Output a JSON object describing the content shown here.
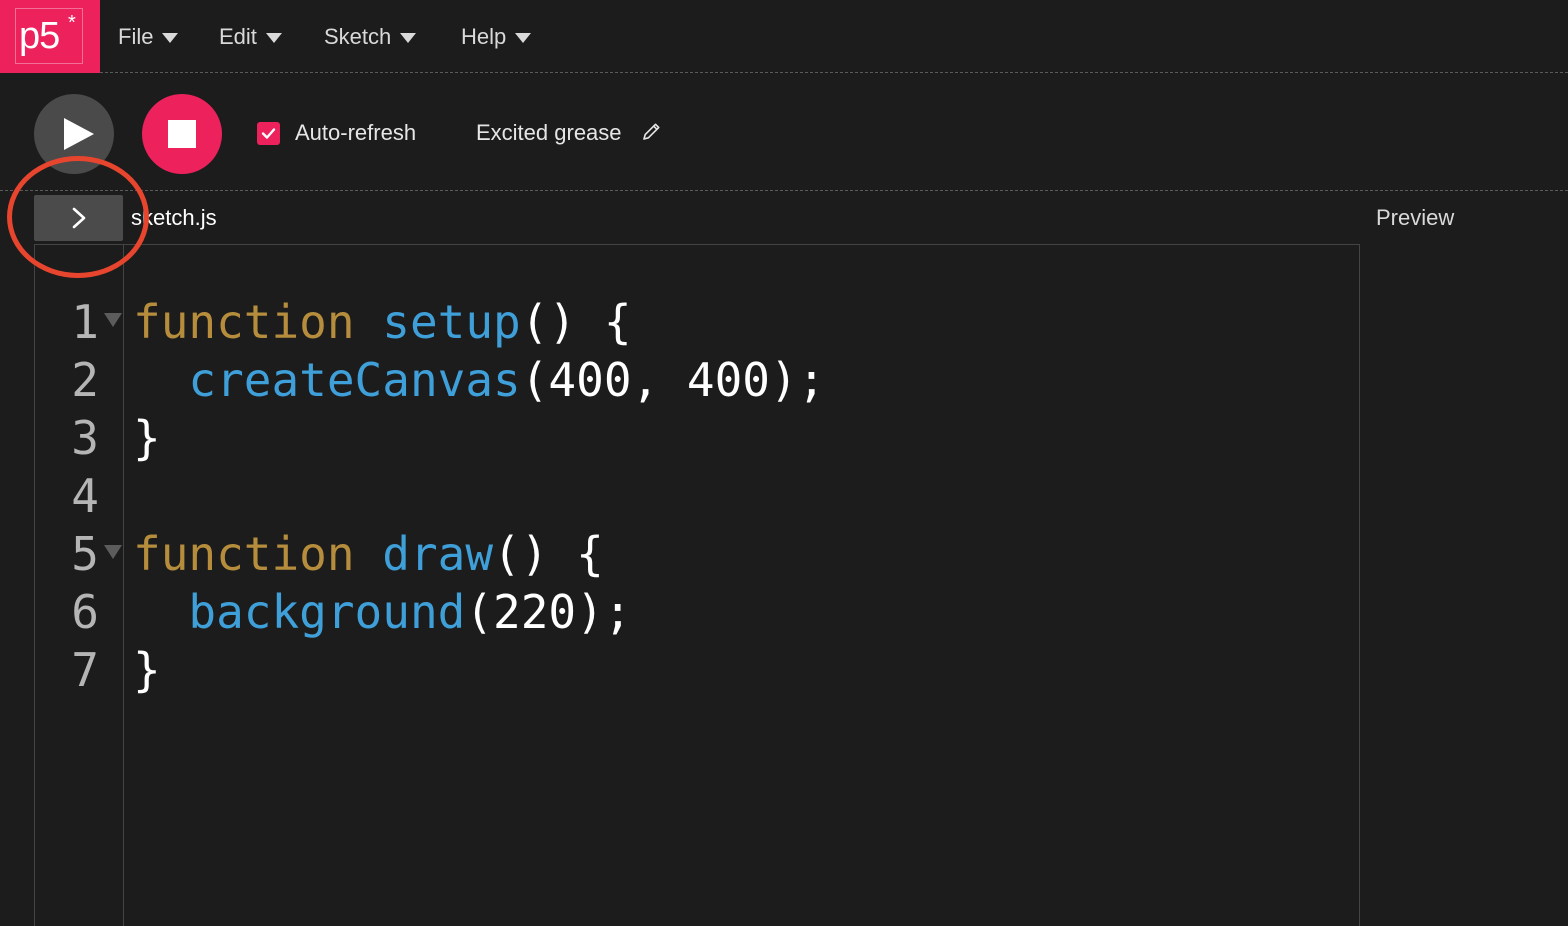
{
  "logo": {
    "text": "p5",
    "star": "*"
  },
  "menu": [
    {
      "label": "File"
    },
    {
      "label": "Edit"
    },
    {
      "label": "Sketch"
    },
    {
      "label": "Help"
    }
  ],
  "toolbar": {
    "auto_refresh_label": "Auto-refresh",
    "auto_refresh_checked": true,
    "sketch_name": "Excited grease"
  },
  "editor": {
    "file_tab": "sketch.js",
    "preview_label": "Preview",
    "lines": [
      {
        "num": "1",
        "foldable": true,
        "tokens": [
          {
            "t": "function",
            "c": "kw"
          },
          {
            "t": " ",
            "c": "pl"
          },
          {
            "t": "setup",
            "c": "fn"
          },
          {
            "t": "() {",
            "c": "pl"
          }
        ]
      },
      {
        "num": "2",
        "foldable": false,
        "tokens": [
          {
            "t": "  ",
            "c": "pl"
          },
          {
            "t": "createCanvas",
            "c": "fn"
          },
          {
            "t": "(400, 400);",
            "c": "pl"
          }
        ]
      },
      {
        "num": "3",
        "foldable": false,
        "tokens": [
          {
            "t": "}",
            "c": "pl"
          }
        ]
      },
      {
        "num": "4",
        "foldable": false,
        "tokens": []
      },
      {
        "num": "5",
        "foldable": true,
        "tokens": [
          {
            "t": "function",
            "c": "kw"
          },
          {
            "t": " ",
            "c": "pl"
          },
          {
            "t": "draw",
            "c": "fn"
          },
          {
            "t": "() {",
            "c": "pl"
          }
        ]
      },
      {
        "num": "6",
        "foldable": false,
        "tokens": [
          {
            "t": "  ",
            "c": "pl"
          },
          {
            "t": "background",
            "c": "fn"
          },
          {
            "t": "(220);",
            "c": "pl"
          }
        ]
      },
      {
        "num": "7",
        "foldable": false,
        "tokens": [
          {
            "t": "}",
            "c": "pl"
          }
        ]
      }
    ]
  },
  "colors": {
    "brand": "#ed225d",
    "keyword": "#b58d3c",
    "function": "#3f9fd9",
    "annotation": "#e8452e"
  },
  "icons": {
    "play": "play-icon",
    "stop": "stop-icon",
    "check": "check-icon",
    "pencil": "pencil-icon",
    "sidebar_toggle": "chevron-right-icon"
  }
}
